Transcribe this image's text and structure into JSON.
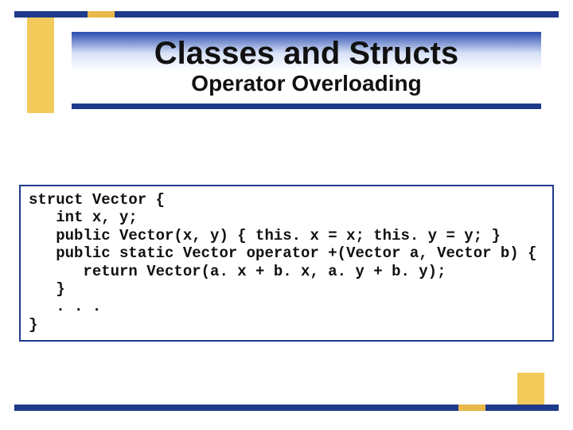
{
  "header": {
    "title": "Classes and Structs",
    "subtitle": "Operator Overloading"
  },
  "code": {
    "lines": [
      "struct Vector {",
      "   int x, y;",
      "   public Vector(x, y) { this. x = x; this. y = y; }",
      "   public static Vector operator +(Vector a, Vector b) {",
      "      return Vector(a. x + b. x, a. y + b. y);",
      "   }",
      "   . . .",
      "}"
    ]
  },
  "colors": {
    "accent_blue": "#1e3a8a",
    "accent_gold": "#f1ca5a"
  }
}
